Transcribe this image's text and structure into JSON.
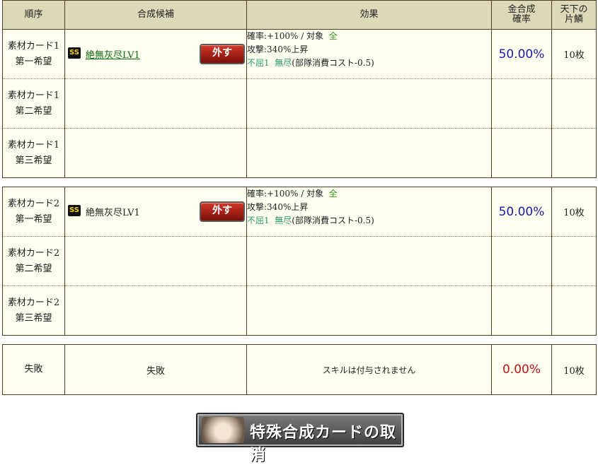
{
  "headers": {
    "order": "順序",
    "candidate": "合成候補",
    "effect": "効果",
    "rate": "金合成確率",
    "tenka": "天下の片鱗"
  },
  "groups": [
    {
      "rows": [
        {
          "order1": "素材カード1",
          "order2": "第一希望",
          "has_skill": true,
          "rank": "SS",
          "skill": "絶無灰尽LV1",
          "remove_label": "外す",
          "effect_line1": "確率:+100%  /  対象",
          "effect_target": "全",
          "effect_line2": "攻撃:340%上昇",
          "effect_l3a": "不屈1",
          "effect_l3b": "無尽",
          "effect_l3c": "(部隊消費コスト-0.5)",
          "rate": "50.00%",
          "tenka": "10枚"
        },
        {
          "order1": "素材カード1",
          "order2": "第二希望",
          "has_skill": false
        },
        {
          "order1": "素材カード1",
          "order2": "第三希望",
          "has_skill": false
        }
      ]
    },
    {
      "rows": [
        {
          "order1": "素材カード2",
          "order2": "第一希望",
          "has_skill": true,
          "rank": "SS",
          "skill": "絶無灰尽LV1",
          "remove_label": "外す",
          "effect_line1": "確率:+100%  /  対象",
          "effect_target": "全",
          "effect_line2": "攻撃:340%上昇",
          "effect_l3a": "不屈1",
          "effect_l3b": "無尽",
          "effect_l3c": "(部隊消費コスト-0.5)",
          "rate": "50.00%",
          "tenka": "10枚"
        },
        {
          "order1": "素材カード2",
          "order2": "第二希望",
          "has_skill": false
        },
        {
          "order1": "素材カード2",
          "order2": "第三希望",
          "has_skill": false
        }
      ]
    }
  ],
  "failure": {
    "order": "失敗",
    "candidate": "失敗",
    "effect": "スキルは付与されません",
    "rate": "0.00%",
    "tenka": "10枚"
  },
  "cancel_button": {
    "label": "特殊合成カードの取消"
  },
  "colors": {
    "header_bg": "#dcd8b8",
    "row_bg": "#fffff0",
    "rate_blue": "#1a1aa8",
    "rate_red": "#c0101a",
    "skill_green": "#0c6b0c"
  }
}
